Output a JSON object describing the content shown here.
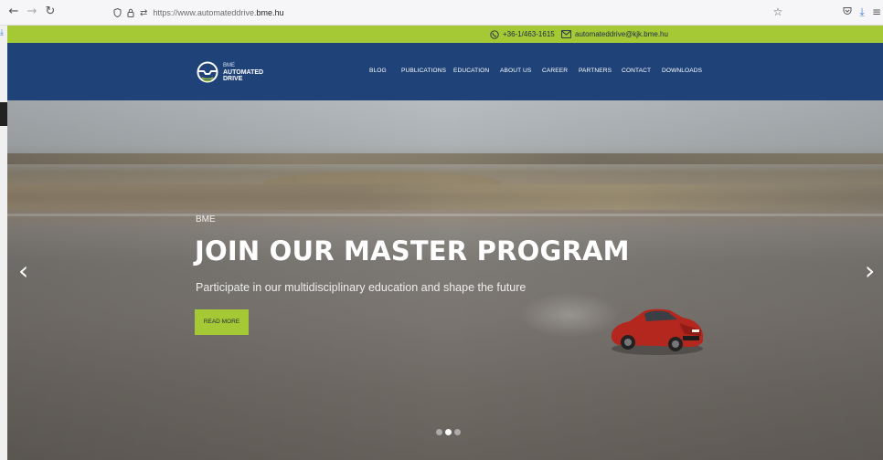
{
  "browser": {
    "url_prefix": "https://www.automateddrive.",
    "url_domain": "bme.hu",
    "icons": [
      "back-icon",
      "forward-icon",
      "reload-icon",
      "shield-icon",
      "lock-icon",
      "permissions-icon",
      "bookmark-star-icon",
      "pocket-icon",
      "download-icon",
      "menu-icon"
    ]
  },
  "topbar": {
    "phone": "+36-1/463-1615",
    "email": "automateddrive@kjk.bme.hu"
  },
  "logo": {
    "line1": "BME",
    "line2": "AUTOMATED",
    "line3": "DRIVE"
  },
  "menu": {
    "items": [
      {
        "label": "BLOG"
      },
      {
        "label": "PUBLICATIONS"
      },
      {
        "label": "EDUCATION"
      },
      {
        "label": "ABOUT US"
      },
      {
        "label": "CAREER"
      },
      {
        "label": "PARTNERS"
      },
      {
        "label": "CONTACT"
      },
      {
        "label": "DOWNLOADS"
      }
    ]
  },
  "hero": {
    "kicker": "BME",
    "headline": "JOIN OUR MASTER PROGRAM",
    "subtitle": "Participate in our multidisciplinary education and shape the future",
    "button_label": "READ MORE",
    "prev_arrow": "‹",
    "next_arrow": "›",
    "slide_count": 3,
    "active_slide": 2
  },
  "colors": {
    "accent_green": "#a5c935",
    "header_blue": "#1f4378"
  }
}
